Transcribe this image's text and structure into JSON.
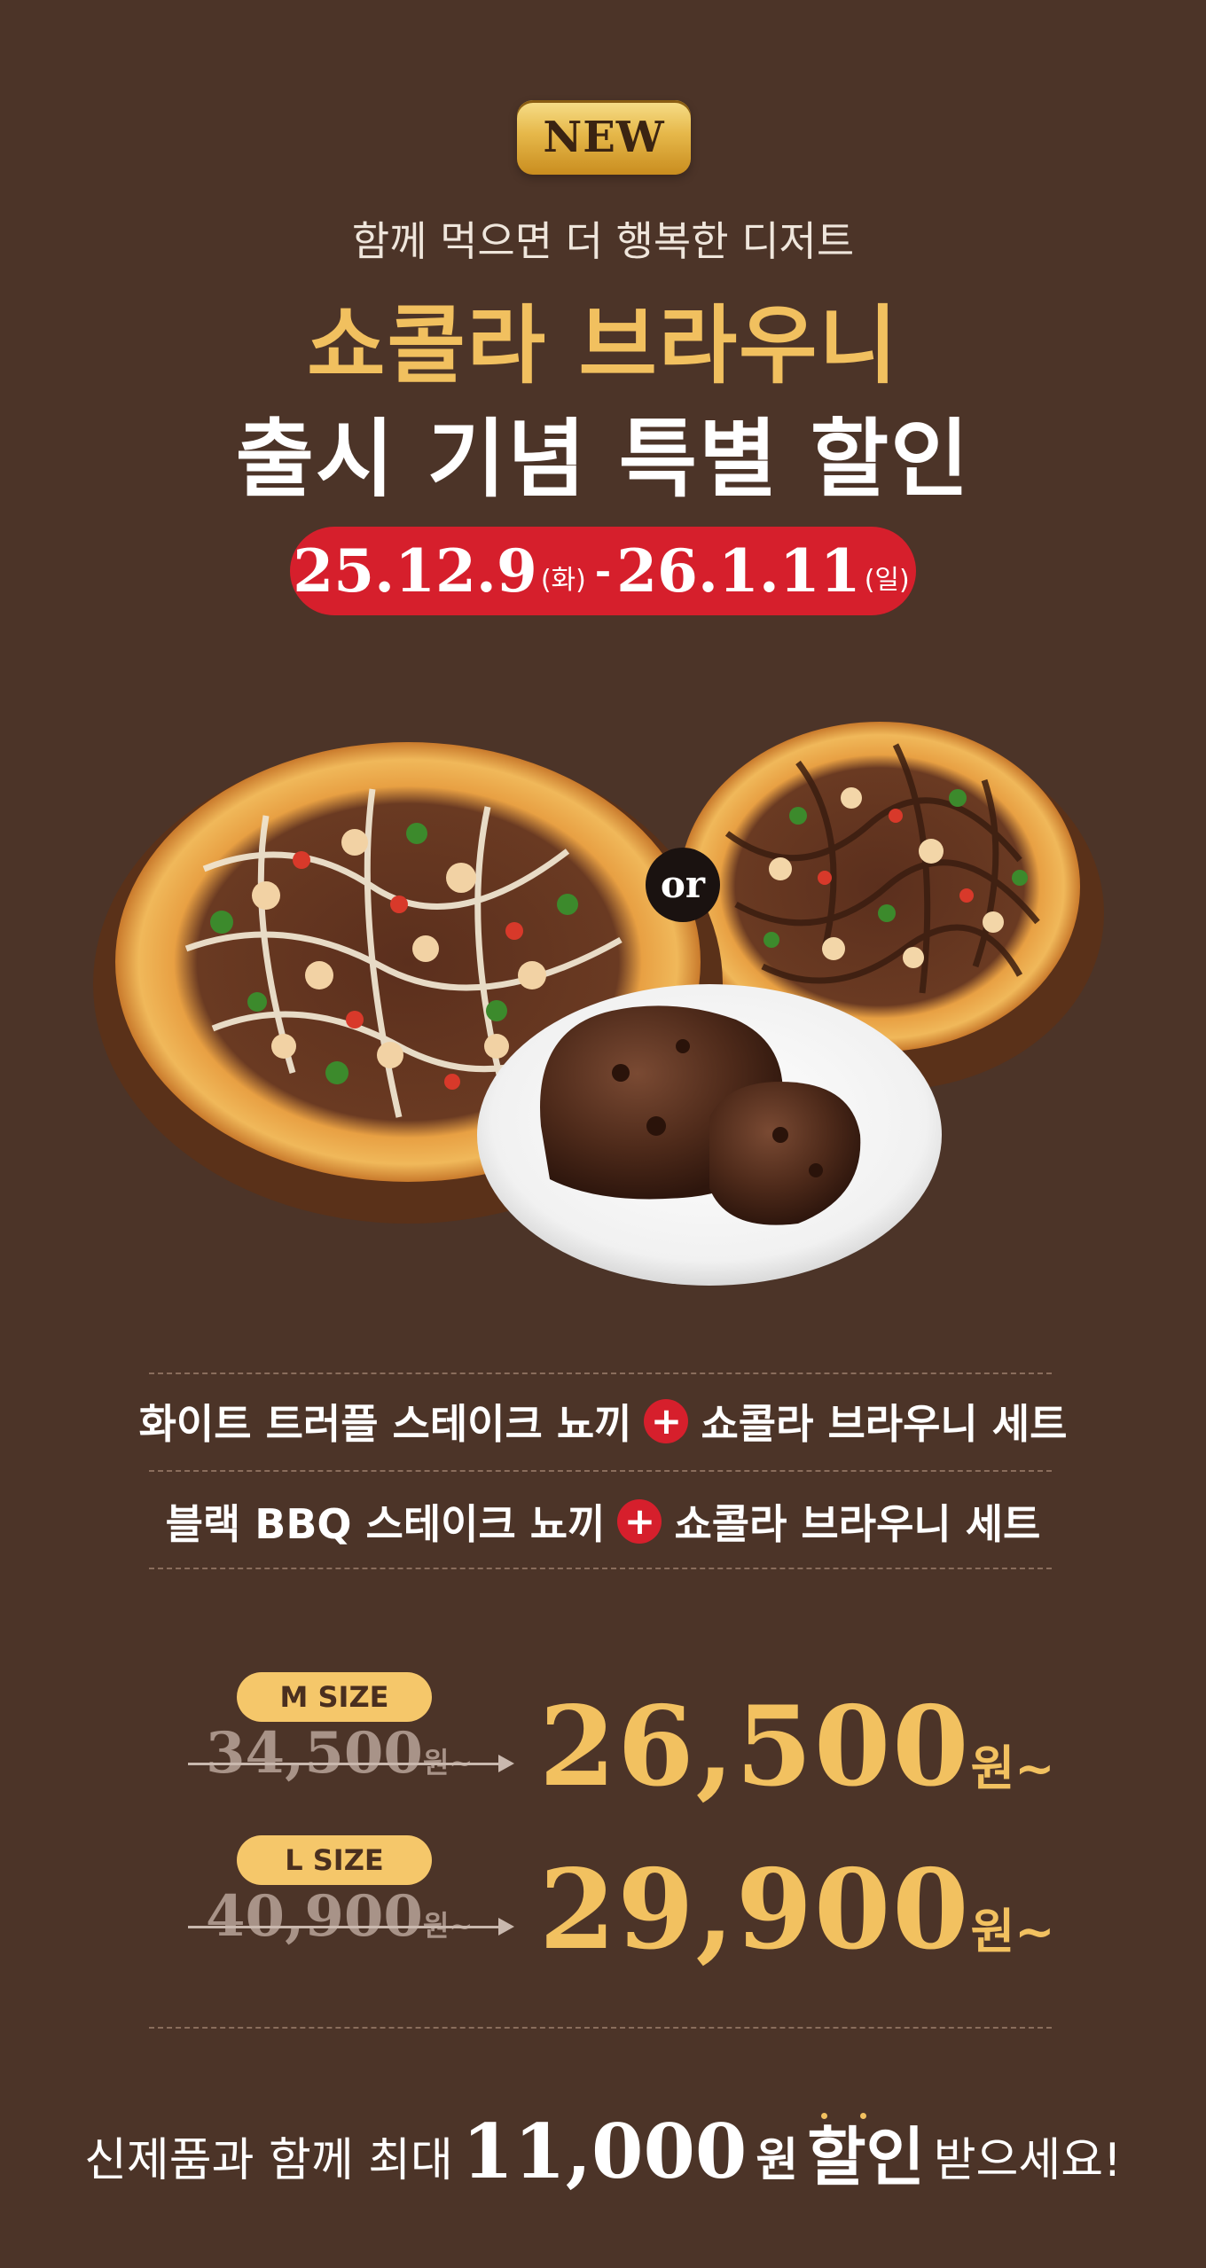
{
  "badge": "NEW",
  "subtitle": "함께 먹으면 더 행복한 디저트",
  "title_gold": "쇼콜라 브라우니",
  "title_white": "출시 기념 특별 할인",
  "date": {
    "start": "25.12.9",
    "start_day": "(화)",
    "separator": "-",
    "end": "26.1.11",
    "end_day": "(일)"
  },
  "or_label": "or",
  "combos": [
    {
      "left": "화이트 트러플 스테이크 뇨끼",
      "plus": "+",
      "right": "쇼콜라 브라우니 세트"
    },
    {
      "left": "블랙 BBQ 스테이크 뇨끼",
      "plus": "+",
      "right": "쇼콜라 브라우니 세트"
    }
  ],
  "prices": [
    {
      "size": "M SIZE",
      "old": "34,500",
      "old_unit": "원~",
      "new": "26,500",
      "new_unit": "원~"
    },
    {
      "size": "L SIZE",
      "old": "40,900",
      "old_unit": "원~",
      "new": "29,900",
      "new_unit": "원~"
    }
  ],
  "bottom": {
    "prefix": "신제품과 함께 최대",
    "amount": "11,000",
    "unit": "원",
    "emph": "할인",
    "suffix": "받으세요!"
  },
  "colors": {
    "background": "#4c3428",
    "gold": "#f2c160",
    "red": "#d61f2c"
  }
}
